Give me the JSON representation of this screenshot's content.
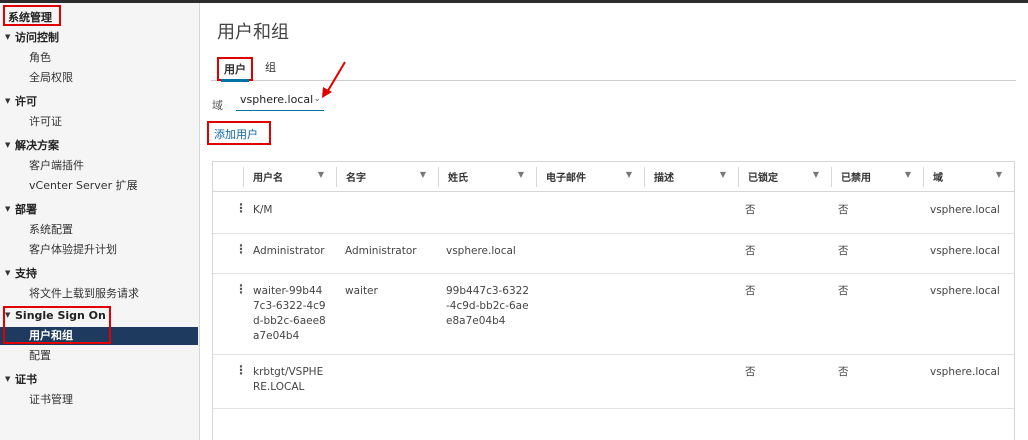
{
  "sidebar": {
    "title": "系统管理",
    "groups": [
      {
        "label": "访问控制",
        "items": [
          "角色",
          "全局权限"
        ]
      },
      {
        "label": "许可",
        "items": [
          "许可证"
        ]
      },
      {
        "label": "解决方案",
        "items": [
          "客户端插件",
          "vCenter Server 扩展"
        ]
      },
      {
        "label": "部署",
        "items": [
          "系统配置",
          "客户体验提升计划"
        ]
      },
      {
        "label": "支持",
        "items": [
          "将文件上载到服务请求"
        ]
      },
      {
        "label": "Single Sign On",
        "items": [
          "用户和组",
          "配置"
        ]
      },
      {
        "label": "证书",
        "items": [
          "证书管理"
        ]
      }
    ],
    "active_item": "用户和组"
  },
  "main": {
    "title": "用户和组",
    "tabs": [
      {
        "label": "用户"
      },
      {
        "label": "组"
      }
    ],
    "active_tab": "用户",
    "domain": {
      "label": "域",
      "value": "vsphere.local"
    },
    "add_user_label": "添加用户"
  },
  "table": {
    "columns": [
      "用户名",
      "名字",
      "姓氏",
      "电子邮件",
      "描述",
      "已锁定",
      "已禁用",
      "域"
    ],
    "rows": [
      {
        "username": [
          "K/M"
        ],
        "first": [
          ""
        ],
        "last": [
          ""
        ],
        "email": "",
        "desc": "",
        "locked": "否",
        "disabled": "否",
        "domain": "vsphere.local"
      },
      {
        "username": [
          "Administrator"
        ],
        "first": [
          "Administrator"
        ],
        "last": [
          "vsphere.local"
        ],
        "email": "",
        "desc": "",
        "locked": "否",
        "disabled": "否",
        "domain": "vsphere.local"
      },
      {
        "username": [
          "waiter-99b44",
          "7c3-6322-4c9",
          "d-bb2c-6aee8",
          "a7e04b4"
        ],
        "first": [
          "waiter"
        ],
        "last": [
          "99b447c3-6322",
          "-4c9d-bb2c-6ae",
          "e8a7e04b4"
        ],
        "email": "",
        "desc": "",
        "locked": "否",
        "disabled": "否",
        "domain": "vsphere.local"
      },
      {
        "username": [
          "krbtgt/VSPHE",
          "RE.LOCAL"
        ],
        "first": [
          ""
        ],
        "last": [
          ""
        ],
        "email": "",
        "desc": "",
        "locked": "否",
        "disabled": "否",
        "domain": "vsphere.local"
      }
    ]
  },
  "colors": {
    "accent": "#0072a3",
    "annotation": "#e00000",
    "active_nav": "#1f3a5f"
  }
}
